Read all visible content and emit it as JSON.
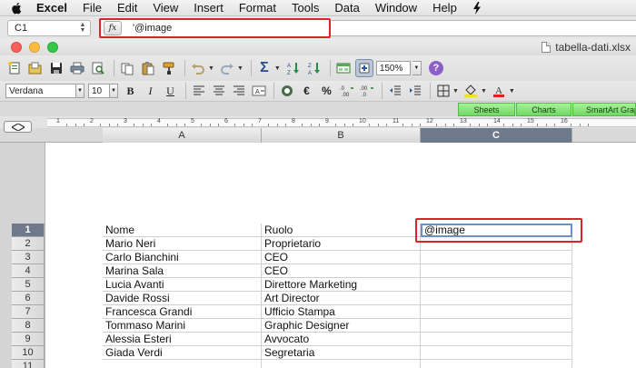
{
  "menubar": {
    "app": "Excel",
    "items": [
      "File",
      "Edit",
      "View",
      "Insert",
      "Format",
      "Tools",
      "Data",
      "Window",
      "Help"
    ]
  },
  "formula_bar": {
    "cell_ref": "C1",
    "fx_label": "fx",
    "formula": "'@image"
  },
  "window": {
    "doc_title": "tabella-dati.xlsx"
  },
  "toolbar": {
    "zoom": "150%",
    "sum_symbol": "Σ",
    "help_symbol": "?"
  },
  "format_toolbar": {
    "font_name": "Verdana",
    "font_size": "10",
    "bold": "B",
    "italic": "I",
    "underline": "U",
    "currency": "€",
    "percent": "%"
  },
  "ribbon": {
    "tabs": [
      "Sheets",
      "Charts",
      "SmartArt Graphics"
    ]
  },
  "ruler": {
    "labels": [
      "1",
      "2",
      "3",
      "4",
      "5",
      "6",
      "7",
      "8",
      "9",
      "10",
      "11",
      "12",
      "13",
      "14",
      "15",
      "16"
    ]
  },
  "sheet": {
    "columns": [
      "A",
      "B",
      "C"
    ],
    "selected_column": "C",
    "row_numbers": [
      "1",
      "2",
      "3",
      "4",
      "5",
      "6",
      "7",
      "8",
      "9",
      "10",
      "11"
    ],
    "selected_row": "1",
    "rows": [
      [
        "Nome",
        "Ruolo",
        "@image"
      ],
      [
        "Mario Neri",
        "Proprietario",
        ""
      ],
      [
        "Carlo Bianchini",
        "CEO",
        ""
      ],
      [
        "Marina Sala",
        "CEO",
        ""
      ],
      [
        "Lucia Avanti",
        "Direttore Marketing",
        ""
      ],
      [
        "Davide Rossi",
        "Art Director",
        ""
      ],
      [
        "Francesca Grandi",
        "Ufficio Stampa",
        ""
      ],
      [
        "Tommaso Marini",
        "Graphic Designer",
        ""
      ],
      [
        "Alessia Esteri",
        "Avvocato",
        ""
      ],
      [
        "Giada Verdi",
        "Segretaria",
        ""
      ]
    ]
  },
  "colors": {
    "highlight_red": "#d9232d",
    "selected_header": "#6e7a8b",
    "ribbon_green": "#6fd862"
  }
}
